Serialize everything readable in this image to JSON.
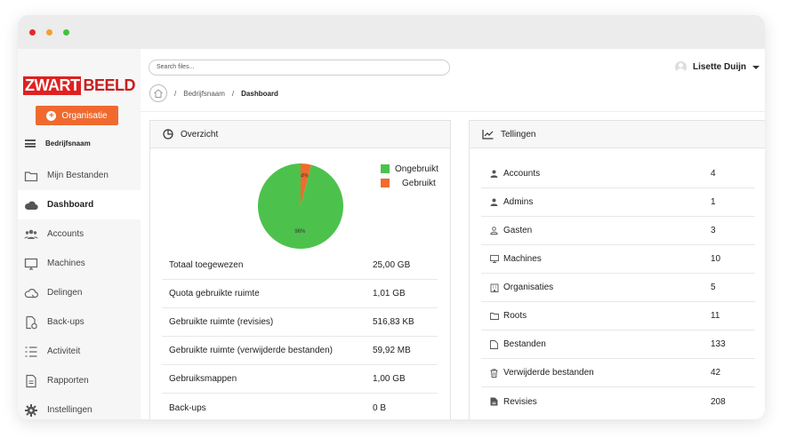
{
  "window": {
    "dots": [
      "#e02a2a",
      "#f0a030",
      "#3ec43e"
    ]
  },
  "logo": {
    "part1": "ZWART",
    "part2": "BEELD"
  },
  "sidebar": {
    "org_button": "Organisatie",
    "company": "Bedrijfsnaam",
    "items": [
      {
        "label": "Mijn Bestanden",
        "icon": "folder-icon"
      },
      {
        "label": "Dashboard",
        "icon": "cloud-icon"
      },
      {
        "label": "Accounts",
        "icon": "users-icon"
      },
      {
        "label": "Machines",
        "icon": "monitor-icon"
      },
      {
        "label": "Delingen",
        "icon": "cloud-share-icon"
      },
      {
        "label": "Back-ups",
        "icon": "backup-file-icon"
      },
      {
        "label": "Activiteit",
        "icon": "activity-list-icon"
      },
      {
        "label": "Rapporten",
        "icon": "report-icon"
      },
      {
        "label": "Instellingen",
        "icon": "gear-icon"
      }
    ]
  },
  "header": {
    "search_placeholder": "Search files...",
    "user_name": "Lisette Duijn"
  },
  "breadcrumb": {
    "company": "Bedrijfsnaam",
    "current": "Dashboard"
  },
  "overview": {
    "title": "Overzicht",
    "legend": [
      {
        "label": "Ongebruikt",
        "color": "#4cc24c"
      },
      {
        "label": "Gebruikt",
        "color": "#ef6b2e"
      }
    ],
    "rows": [
      {
        "label": "Totaal toegewezen",
        "value": "25,00 GB"
      },
      {
        "label": "Quota gebruikte ruimte",
        "value": "1,01 GB"
      },
      {
        "label": "Gebruikte ruimte (revisies)",
        "value": "516,83 KB"
      },
      {
        "label": "Gebruikte ruimte (verwijderde bestanden)",
        "value": "59,92 MB"
      },
      {
        "label": "Gebruiksmappen",
        "value": "1,00 GB"
      },
      {
        "label": "Back-ups",
        "value": "0 B"
      }
    ]
  },
  "chart_data": {
    "type": "pie",
    "categories": [
      "Ongebruikt",
      "Gebruikt"
    ],
    "values": [
      96,
      4
    ],
    "labels": [
      "96%",
      "4%"
    ],
    "colors": [
      "#4cc24c",
      "#ef6b2e"
    ],
    "legend": "top-right"
  },
  "counts": {
    "title": "Tellingen",
    "rows": [
      {
        "label": "Accounts",
        "value": "4",
        "icon": "user-icon"
      },
      {
        "label": "Admins",
        "value": "1",
        "icon": "user-icon"
      },
      {
        "label": "Gasten",
        "value": "3",
        "icon": "user-outline-icon"
      },
      {
        "label": "Machines",
        "value": "10",
        "icon": "monitor-icon"
      },
      {
        "label": "Organisaties",
        "value": "5",
        "icon": "building-icon"
      },
      {
        "label": "Roots",
        "value": "11",
        "icon": "folder-icon"
      },
      {
        "label": "Bestanden",
        "value": "133",
        "icon": "file-icon"
      },
      {
        "label": "Verwijderde bestanden",
        "value": "42",
        "icon": "trash-icon"
      },
      {
        "label": "Revisies",
        "value": "208",
        "icon": "revision-file-icon"
      }
    ]
  }
}
